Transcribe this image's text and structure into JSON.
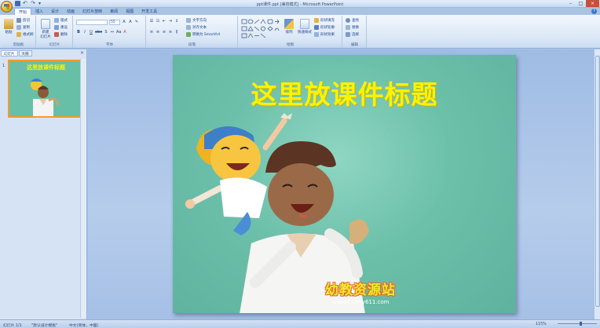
{
  "window": {
    "title": "ppt课件.ppt [兼容模式] - Microsoft PowerPoint"
  },
  "tabs": [
    "开始",
    "插入",
    "设计",
    "动画",
    "幻灯片放映",
    "审阅",
    "视图",
    "开发工具"
  ],
  "ribbon": {
    "clipboard": {
      "paste": "粘贴",
      "cut": "剪切",
      "copy": "复制",
      "format_painter": "格式刷",
      "label": "剪贴板"
    },
    "slides": {
      "new_slide": "新建\n幻灯片",
      "layout": "版式",
      "reset": "重设",
      "delete": "删除",
      "label": "幻灯片"
    },
    "font": {
      "font_name": "",
      "font_size": "55",
      "bold": "B",
      "italic": "I",
      "underline": "U",
      "strike": "abc",
      "shadow": "S",
      "label": "字体"
    },
    "paragraph": {
      "text_direction": "文字方向",
      "align_text": "对齐文本",
      "smartart": "转换为 SmartArt",
      "label": "段落"
    },
    "drawing": {
      "arrange": "排列",
      "quick_styles": "快速样式",
      "shape_fill": "形状填充",
      "shape_outline": "形状轮廓",
      "shape_effects": "形状效果",
      "label": "绘图"
    },
    "editing": {
      "find": "查找",
      "replace": "替换",
      "select": "选择",
      "label": "编辑"
    }
  },
  "panel": {
    "tab_slides": "幻灯片",
    "tab_outline": "大纲",
    "close": "×",
    "slide_number": "1",
    "thumb_title": "这里放课件标题"
  },
  "slide": {
    "title": "这里放课件标题",
    "watermark_cn": "幼教资源站",
    "watermark_url": "ziyuan.baby611.com"
  },
  "statusbar": {
    "slide_info": "幻灯片 1/1",
    "theme": "\"默认设计模板\"",
    "language": "中文(简体，中国)",
    "zoom": "115%"
  },
  "colors": {
    "title_yellow": "#fff200",
    "slide_bg": "#6cc0aa",
    "selection_orange": "#f39a2b",
    "ribbon_blue": "#dbe7f6"
  }
}
